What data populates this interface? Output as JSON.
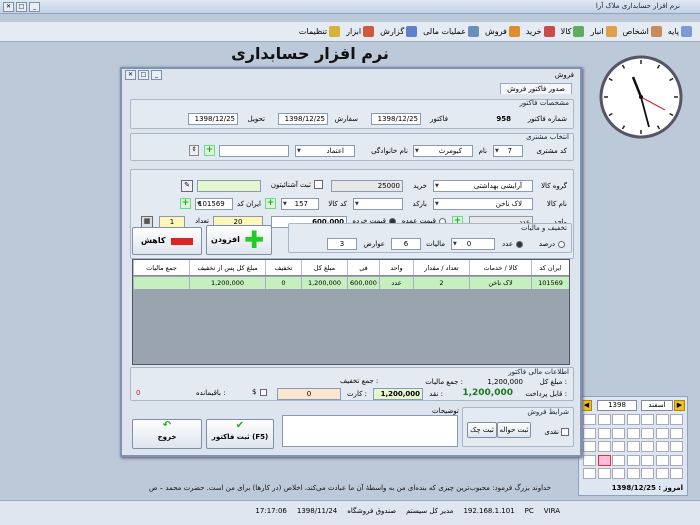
{
  "window": {
    "title": "نرم افزار حسابداری ملاک آرا"
  },
  "menu": [
    {
      "label": "پایه",
      "icon": "home-icon",
      "color": "#7b9ad6"
    },
    {
      "label": "اشخاص",
      "icon": "people-icon",
      "color": "#c98b5a"
    },
    {
      "label": "انبار",
      "icon": "warehouse-icon",
      "color": "#e0a04a"
    },
    {
      "label": "کالا",
      "icon": "box-icon",
      "color": "#5fae5f"
    },
    {
      "label": "خرید",
      "icon": "cart-icon",
      "color": "#c94b4b"
    },
    {
      "label": "فروش",
      "icon": "sell-icon",
      "color": "#e08c2a"
    },
    {
      "label": "عملیات مالی",
      "icon": "finance-icon",
      "color": "#6a8fb8"
    },
    {
      "label": "گزارش",
      "icon": "report-icon",
      "color": "#5f7fc8"
    },
    {
      "label": "ابزار",
      "icon": "tools-icon",
      "color": "#d05a3a"
    },
    {
      "label": "تنظیمات",
      "icon": "settings-icon",
      "color": "#d6b23a"
    }
  ],
  "app_title": "نرم افزار حسابداری",
  "dialog": {
    "title": "فروش",
    "tab": "صدور فاکتور فروش",
    "invoice": {
      "group": "مشخصات فاکتور",
      "number_label": "شماره فاکتور",
      "number": "958",
      "invoice_date_label": "فاکتور",
      "invoice_date": "1398/12/25",
      "order_label": "سفارش",
      "order_date": "1398/12/25",
      "delivery_label": "تحویل",
      "delivery_date": "1398/12/25"
    },
    "customer": {
      "group": "انتخاب مشتری",
      "code_label": "کد مشتری",
      "code": "7",
      "name_label": "نام",
      "name": "کیومرث",
      "family_label": "نام خانوادگی",
      "family": "اعتماد",
      "search": ""
    },
    "goods": {
      "group_label": "گروه کالا",
      "group_value": "آرایشی بهداشتی",
      "buy_label": "خرید",
      "buy_value": "25000",
      "name_label": "نام کالا",
      "name_value": "لاک ناخن",
      "barcode_label": "بارکد",
      "code_label": "کد کالا",
      "code_value": "157",
      "iran_code_label": "ایران کد",
      "iran_code": "101569",
      "unit_label": "واحد",
      "unit": "عدد",
      "retail_label": "قیمت خرده",
      "wholesale_label": "قیمت عمده",
      "price": "600,000",
      "qty_label": "تعداد",
      "qty": "1",
      "extra": "20",
      "register_label": "ثبت آشنائیتون",
      "register_value": ""
    },
    "discount": {
      "group": "تخفیف و مالیات",
      "percent_label": "درصد",
      "each_label": "عدد",
      "each_value": "0",
      "tax_label": "مالیات",
      "tax_value": "6",
      "duty_label": "عوارض",
      "duty_value": "3"
    },
    "buttons": {
      "add": "افزودن",
      "remove": "کاهش",
      "save": "ثبت فاکتور (F5)",
      "exit": "خروج"
    },
    "grid": {
      "headers": [
        "ایران کد",
        "کالا / خدمات",
        "تعداد / مقدار",
        "واحد",
        "فی",
        "مبلغ کل",
        "تخفیف",
        "مبلغ کل پس از تخفیف",
        "جمع مالیات"
      ],
      "rows": [
        [
          "101569",
          "لاک ناخن",
          "2",
          "عدد",
          "600,000",
          "1,200,000",
          "0",
          "1,200,000",
          ""
        ]
      ]
    },
    "totals": {
      "group": "اطلاعات مالی فاکتور",
      "total_label": "مبلغ کل :",
      "total_value": "1,200,000",
      "tax_label": "جمع مالیات :",
      "discount_label": "جمع تخفیف :",
      "payable_label": "قابل پرداخت :",
      "payable": "1,200,000",
      "cash_label": "نقد :",
      "cash": "1,200,000",
      "card_label": "کارت :",
      "card": "0",
      "remain_label": "باقیمانده :",
      "remain": "0",
      "currency": "$"
    },
    "notes_label": "توضیحات",
    "conditions": {
      "group": "شرایط فروش",
      "cash": "نقدی",
      "check": "ثبت چک",
      "transfer": "ثبت حواله"
    }
  },
  "calendar": {
    "month": "اسفند",
    "year": "1398",
    "today_label": "امروز : 1398/12/25"
  },
  "scroll_text": "خداوند بزرگ فرمود: محبوب‌ترین چیزی که بنده‌ای من به واسطهٔ آن ما عبادت می‌کند، اخلاص (در کارها) برای من است. حضرت محمد – ص",
  "status": {
    "items": [
      "VIRA",
      "PC",
      "192.168.1.101",
      "مدیر کل سیستم",
      "صندوق فروشگاه",
      "1398/11/24",
      "17:17:06"
    ]
  }
}
